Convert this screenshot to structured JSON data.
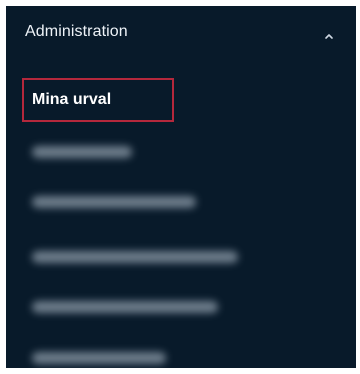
{
  "sidebar": {
    "section_title": "Administration",
    "expanded_icon": "chevron-up-icon",
    "active_item": {
      "label": "Mina urval",
      "highlight_color": "#b4283c"
    },
    "blurred_items_count_note": ""
  },
  "colors": {
    "panel_background": "#081a2a",
    "text": "#ffffff",
    "blurred_text": "#7f8e9c"
  }
}
